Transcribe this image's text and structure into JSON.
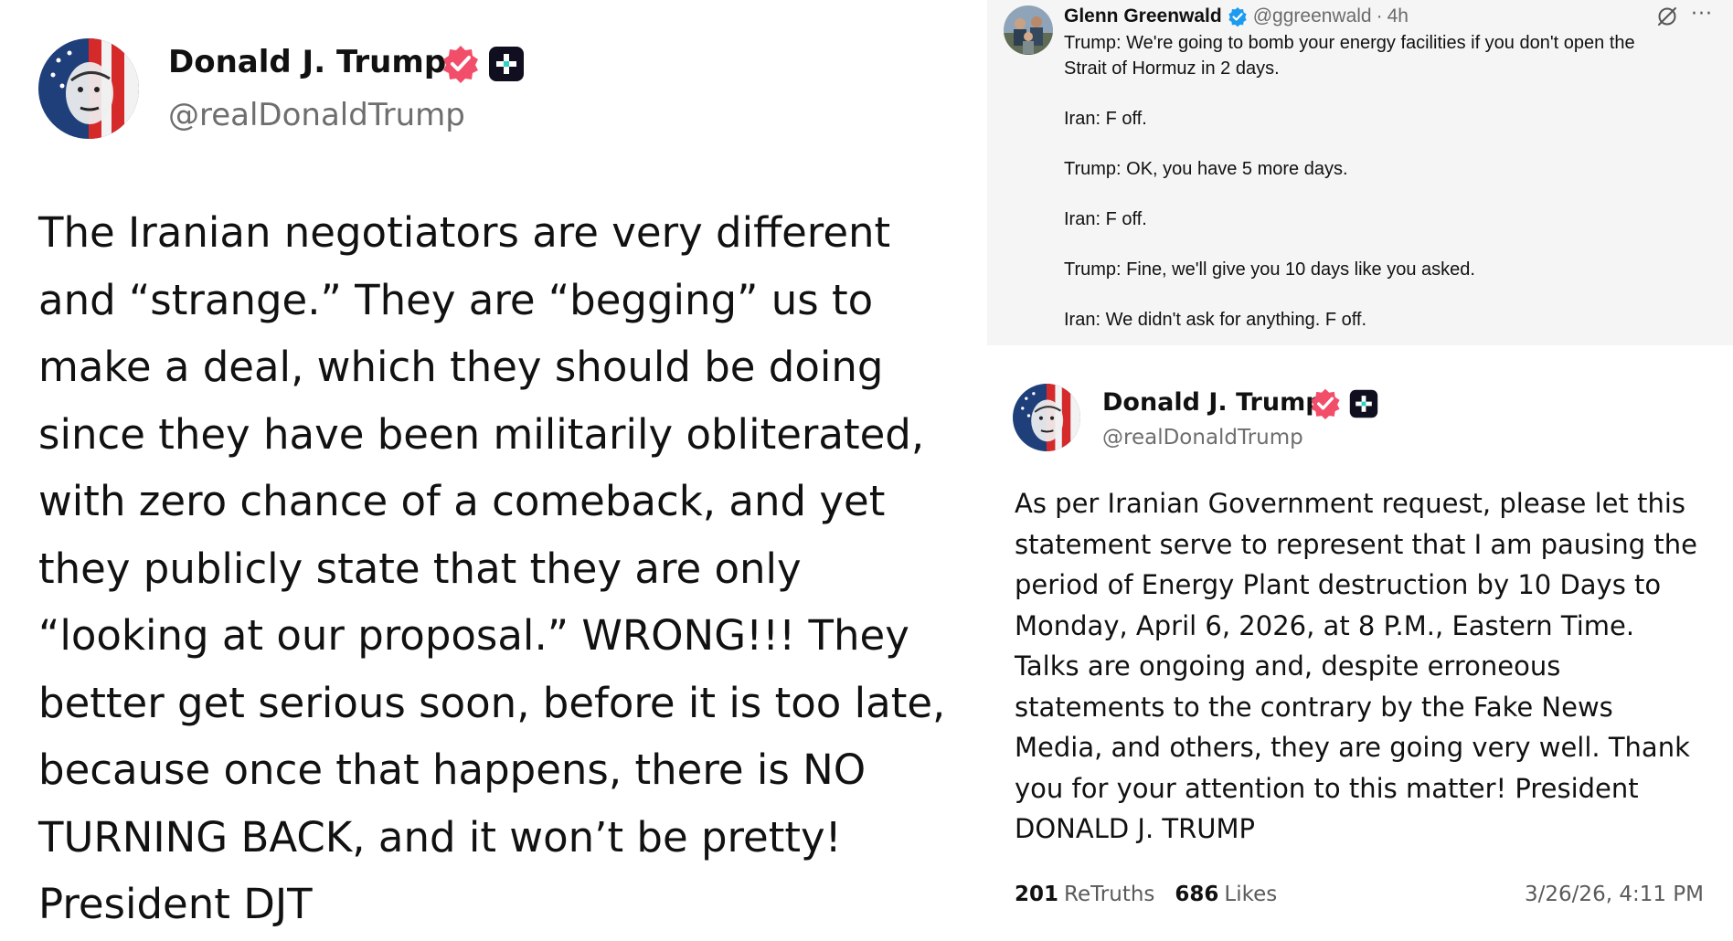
{
  "colors": {
    "text": "#111111",
    "muted": "#6e6e6e",
    "truth_verified_badge": "#f24e6a",
    "x_verified_badge": "#1d9bf0",
    "tweet_background": "#f5f5f5"
  },
  "left_post": {
    "avatar_icon": "american-flag-portrait-avatar",
    "author_name": "Donald J. Trump",
    "handle": "@realDonaldTrump",
    "verified_icon": "verified-badge-icon",
    "plus_icon": "truth-plus-icon",
    "body_lines": [
      "The Iranian negotiators are very different",
      "and “strange.” They are “begging” us to",
      "make a deal, which they should be doing",
      "since they have been militarily obliterated,",
      "with zero chance of a comeback, and yet",
      "they publicly state that they are only",
      "“looking at our proposal.” WRONG!!! They",
      "better get serious soon, before it is too late,",
      "because once that happens, there is NO",
      "TURNING BACK, and it won’t be pretty!",
      "President DJT"
    ]
  },
  "tweet": {
    "avatar_icon": "group-photo-avatar",
    "author_name": "Glenn Greenwald",
    "handle": "@ggreenwald",
    "separator": "·",
    "time": "4h",
    "grok_icon": "grok-icon",
    "more_label": "···",
    "lines": {
      "l1": "Trump: We're going to bomb your energy facilities if you don't open the",
      "l2": "Strait of Hormuz in 2 days.",
      "l3": "Iran: F off.",
      "l4": "Trump: OK, you have 5 more days.",
      "l5": "Iran: F off.",
      "l6": "Trump: Fine, we'll give you 10 days like you asked.",
      "l7": "Iran: We didn't ask for anything. F off."
    }
  },
  "right_post": {
    "avatar_icon": "american-flag-portrait-avatar",
    "author_name": "Donald J. Trump",
    "handle": "@realDonaldTrump",
    "verified_icon": "verified-badge-icon",
    "plus_icon": "truth-plus-icon",
    "body_lines": [
      "As per Iranian Government request, please let this",
      "statement serve to represent that I am pausing the",
      "period of Energy Plant destruction by 10 Days to",
      "Monday, April 6, 2026, at 8 P.M., Eastern Time.",
      "Talks are ongoing and, despite erroneous",
      "statements to the contrary by the Fake News",
      "Media, and others, they are going very well. Thank",
      "you for your attention to this matter! President",
      "DONALD J. TRUMP"
    ],
    "retruths_count": "201",
    "retruths_label": "ReTruths",
    "likes_count": "686",
    "likes_label": "Likes",
    "timestamp": "3/26/26, 4:11 PM"
  }
}
